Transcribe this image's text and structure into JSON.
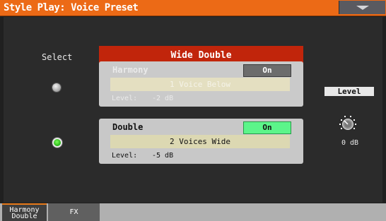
{
  "title": "Style Play: Voice Preset",
  "menu_icon": "triangle-down-icon",
  "select_label": "Select",
  "preset_name": "Wide Double",
  "harmony": {
    "name": "Harmony",
    "toggle": "On",
    "value": "1 Voice Below",
    "level_label": "Level:",
    "level_value": "-2 dB",
    "selected": false
  },
  "double": {
    "name": "Double",
    "toggle": "On",
    "value": "2 Voices Wide",
    "level_label": "Level:",
    "level_value": "-5 dB",
    "selected": true
  },
  "level": {
    "label": "Level",
    "value": "0 dB"
  },
  "tabs": [
    {
      "line1": "Harmony",
      "line2": "Double",
      "active": true
    },
    {
      "label": "FX",
      "active": false
    }
  ],
  "colors": {
    "titlebar": "#ec6a16",
    "preset_box": "#c1250b",
    "on_green": "#5cf58a",
    "radio_green": "#24b314"
  }
}
